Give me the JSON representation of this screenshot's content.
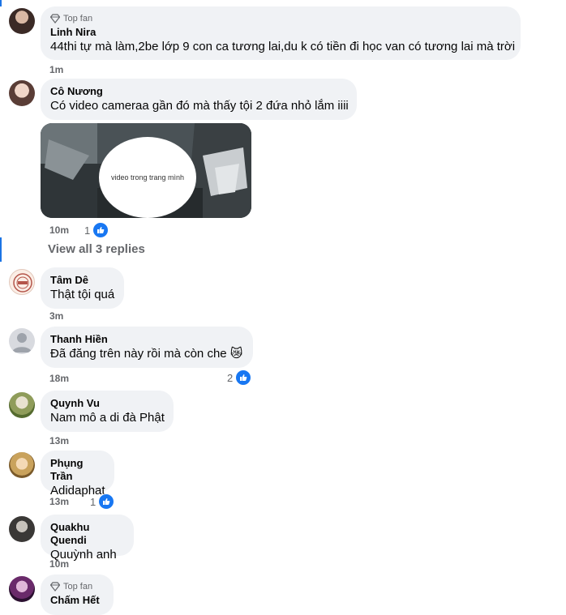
{
  "comments": [
    {
      "badge": "Top fan",
      "author": "Linh Nira",
      "text": "44thi tự mà làm,2be lớp 9 con ca tương lai,du k có tiền đi học van có tương lai mà trời",
      "time": "1m"
    },
    {
      "author": "Cô Nương",
      "text": "Có video cameraa gần đó mà thấy tội 2 đứa nhỏ lắm iiii",
      "time": "10m",
      "likes": "1",
      "media_caption": "video trong trang mình"
    },
    {
      "author": "Tâm Dê",
      "text": "Thật tội quá",
      "time": "3m"
    },
    {
      "author": "Thanh Hiền",
      "text": "Đã đăng trên này rồi mà còn che 😿",
      "time": "18m",
      "likes": "2"
    },
    {
      "author": "Quynh Vu",
      "text": "Nam mô a di đà Phật",
      "time": "13m"
    },
    {
      "author": "Phụng Trần",
      "text": "Adidaphat",
      "time": "13m",
      "likes": "1"
    },
    {
      "author": "Quakhu Quendi",
      "text": "Quuỳnh anh",
      "time": "10m"
    },
    {
      "badge": "Top fan",
      "author": "Chấm Hết"
    }
  ],
  "view_replies_label": "View all 3 replies",
  "colors": {
    "bubble": "#f0f2f5",
    "like_blue": "#1877f2",
    "meta_gray": "#65676b",
    "thread_line": "#1b74e4"
  },
  "icons": {
    "badge": "diamond-icon",
    "like": "thumbs-up-icon"
  }
}
